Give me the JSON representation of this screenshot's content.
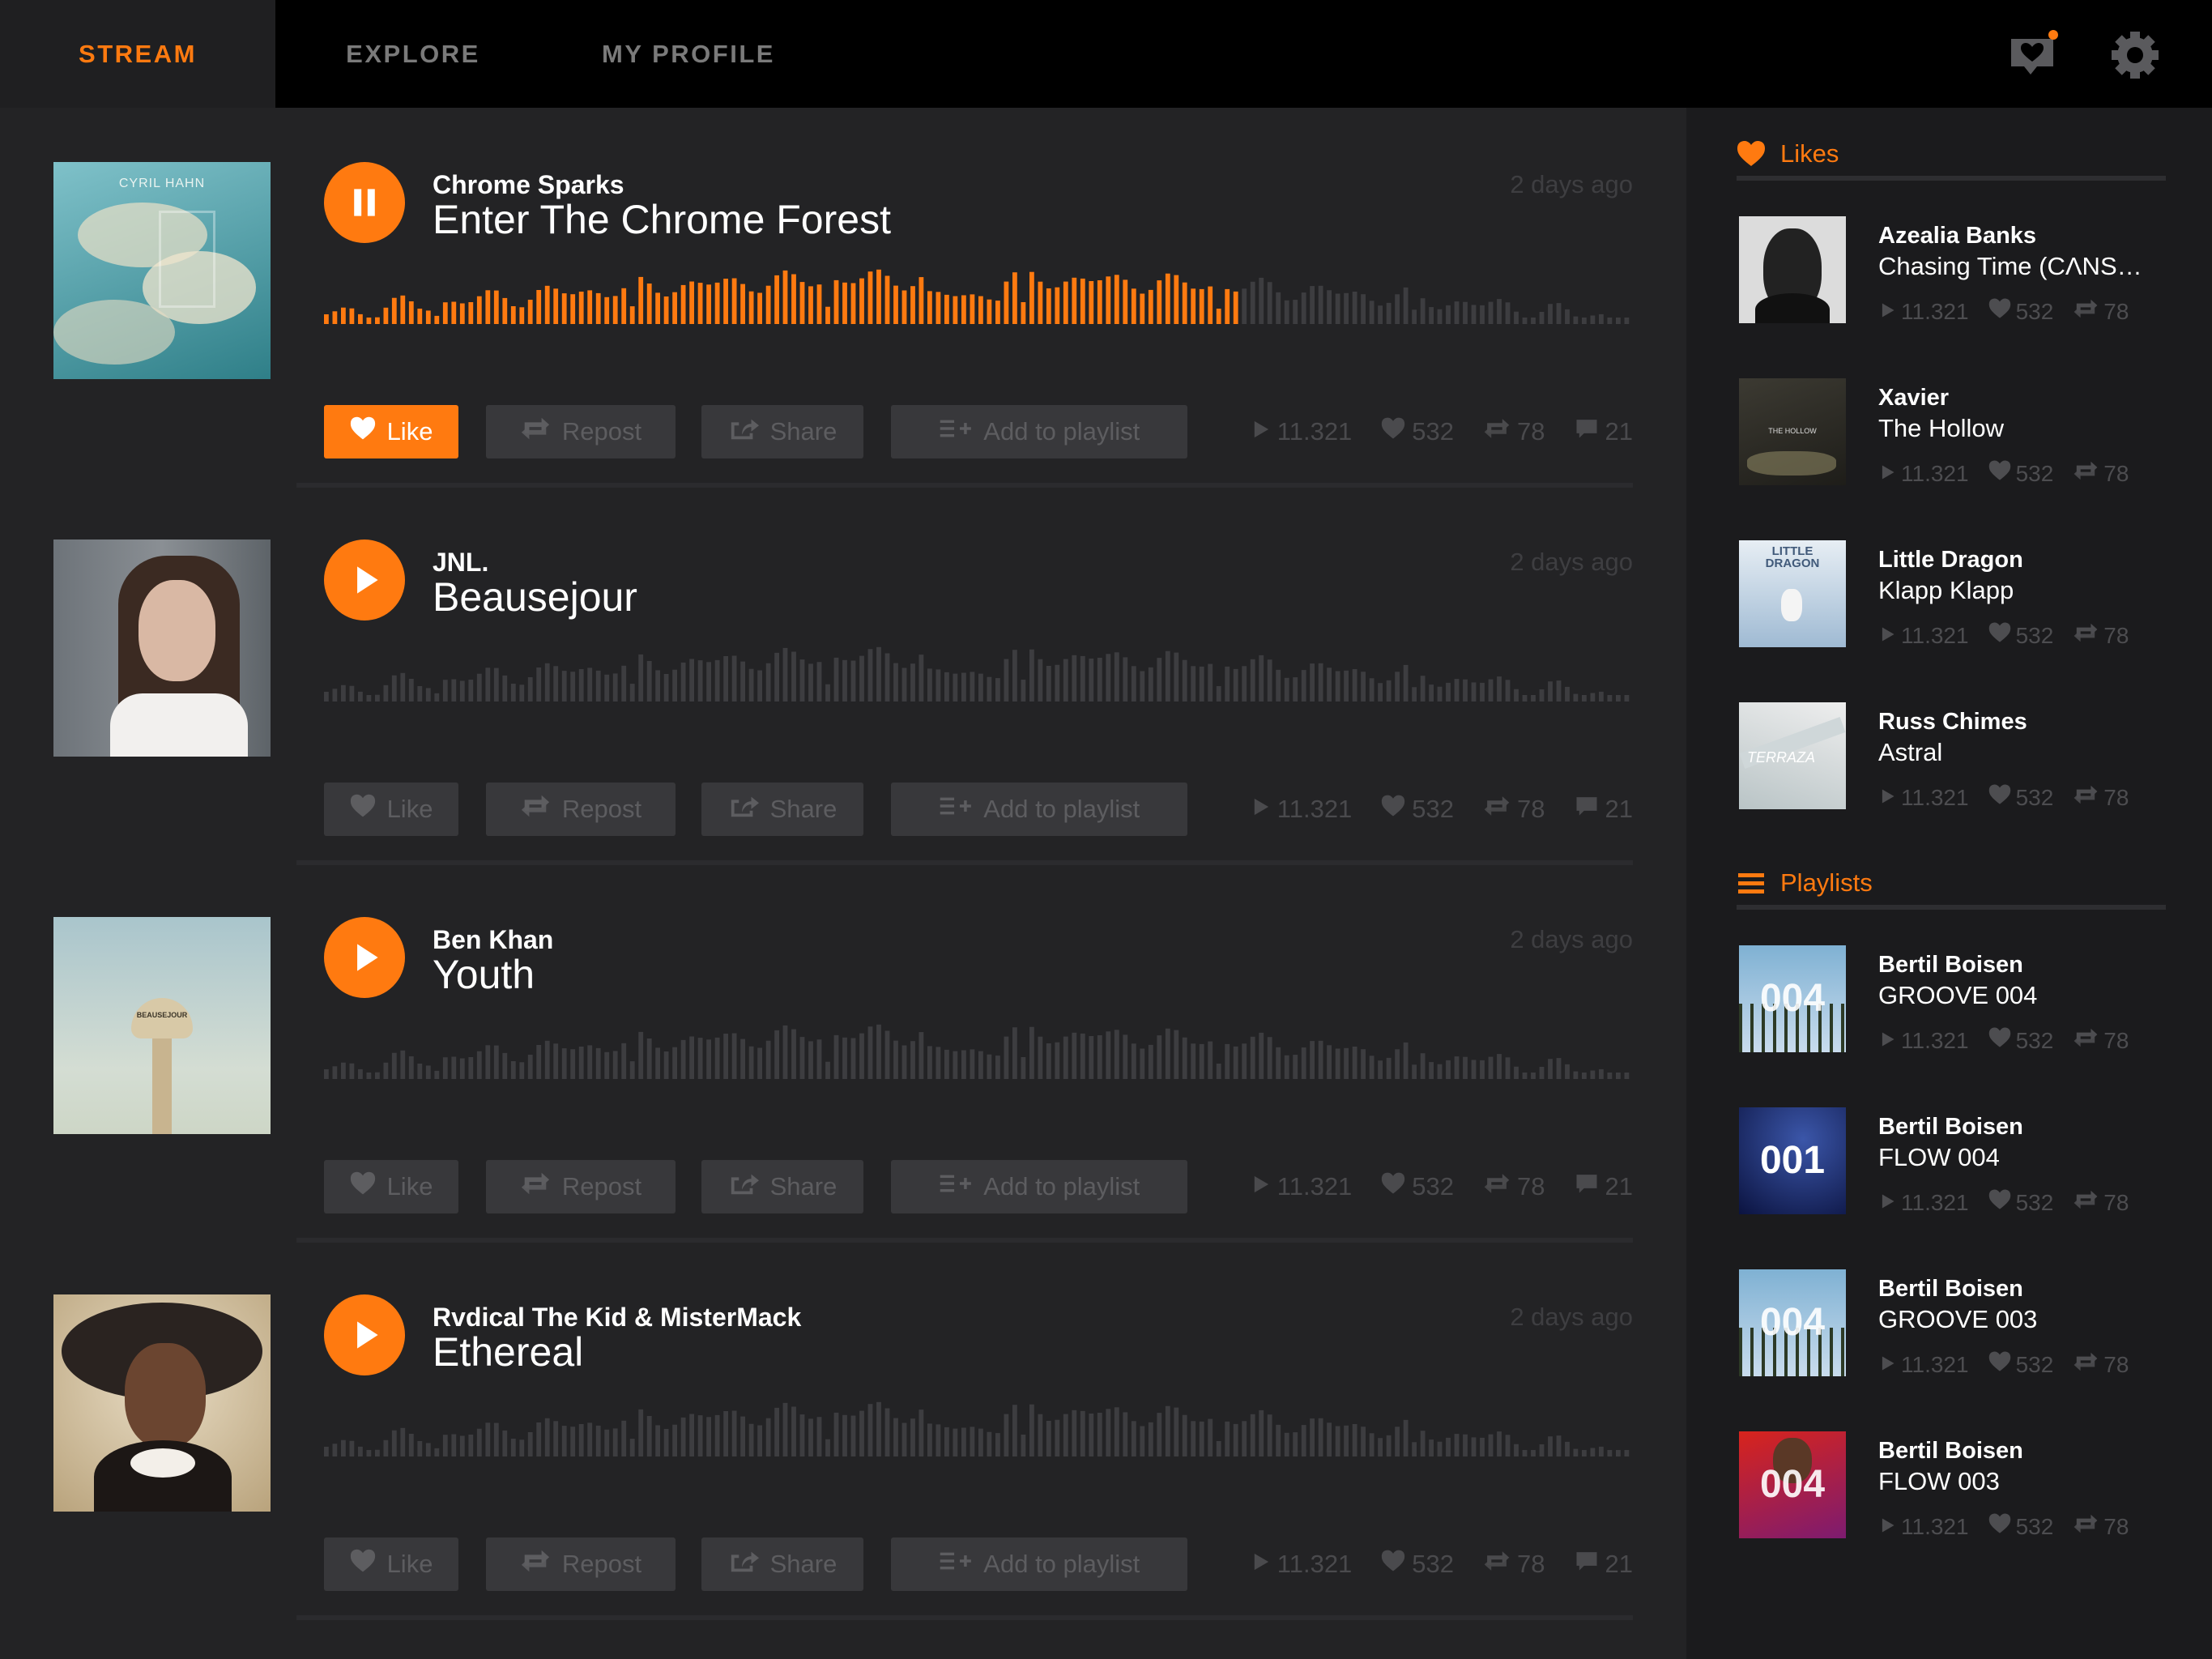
{
  "nav": {
    "tabs": [
      {
        "label": "STREAM",
        "active": true
      },
      {
        "label": "EXPLORE",
        "active": false
      },
      {
        "label": "MY PROFILE",
        "active": false
      }
    ],
    "icons": [
      "notification-heart-icon",
      "gear-icon"
    ]
  },
  "colors": {
    "accent": "#ff7a10",
    "background": "#232325",
    "sidebar": "#1b1b1d",
    "topbar": "#000000",
    "muted": "#4a4a4d"
  },
  "labels": {
    "like": "Like",
    "repost": "Repost",
    "share": "Share",
    "add_to_playlist": "Add to playlist"
  },
  "stream": [
    {
      "artist": "Chrome Sparks",
      "title": "Enter The Chrome Forest",
      "time": "2 days ago",
      "playing": true,
      "liked": true,
      "progress": 0.7,
      "plays": "11.321",
      "likes": "532",
      "reposts": "78",
      "comments": "21",
      "art_text": "CYRIL HAHN"
    },
    {
      "artist": "JNL.",
      "title": "Beausejour",
      "time": "2 days ago",
      "playing": false,
      "liked": false,
      "progress": 0,
      "plays": "11.321",
      "likes": "532",
      "reposts": "78",
      "comments": "21"
    },
    {
      "artist": "Ben Khan",
      "title": "Youth",
      "time": "2 days ago",
      "playing": false,
      "liked": false,
      "progress": 0,
      "plays": "11.321",
      "likes": "532",
      "reposts": "78",
      "comments": "21",
      "art_text": "BEAUSEJOUR"
    },
    {
      "artist": "Rvdical The Kid & MisterMack",
      "title": "Ethereal",
      "time": "2 days ago",
      "playing": false,
      "liked": false,
      "progress": 0,
      "plays": "11.321",
      "likes": "532",
      "reposts": "78",
      "comments": "21"
    }
  ],
  "sidebar": {
    "likes_heading": "Likes",
    "playlists_heading": "Playlists",
    "likes": [
      {
        "artist": "Azealia Banks",
        "title": "Chasing Time (CΛNS…",
        "plays": "11.321",
        "likes": "532",
        "reposts": "78"
      },
      {
        "artist": "Xavier",
        "title": "The Hollow",
        "plays": "11.321",
        "likes": "532",
        "reposts": "78",
        "art_text": "THE HOLLOW"
      },
      {
        "artist": "Little Dragon",
        "title": "Klapp Klapp",
        "plays": "11.321",
        "likes": "532",
        "reposts": "78",
        "art_text": "LITTLE DRAGON"
      },
      {
        "artist": "Russ Chimes",
        "title": "Astral",
        "plays": "11.321",
        "likes": "532",
        "reposts": "78",
        "art_text": "TERRAZA"
      }
    ],
    "playlists": [
      {
        "artist": "Bertil Boisen",
        "title": "GROOVE 004",
        "plays": "11.321",
        "likes": "532",
        "reposts": "78",
        "art_text": "004"
      },
      {
        "artist": "Bertil Boisen",
        "title": "FLOW 004",
        "plays": "11.321",
        "likes": "532",
        "reposts": "78",
        "art_text": "001"
      },
      {
        "artist": "Bertil Boisen",
        "title": "GROOVE 003",
        "plays": "11.321",
        "likes": "532",
        "reposts": "78",
        "art_text": "004"
      },
      {
        "artist": "Bertil Boisen",
        "title": "FLOW 003",
        "plays": "11.321",
        "likes": "532",
        "reposts": "78",
        "art_text": "004"
      }
    ]
  }
}
